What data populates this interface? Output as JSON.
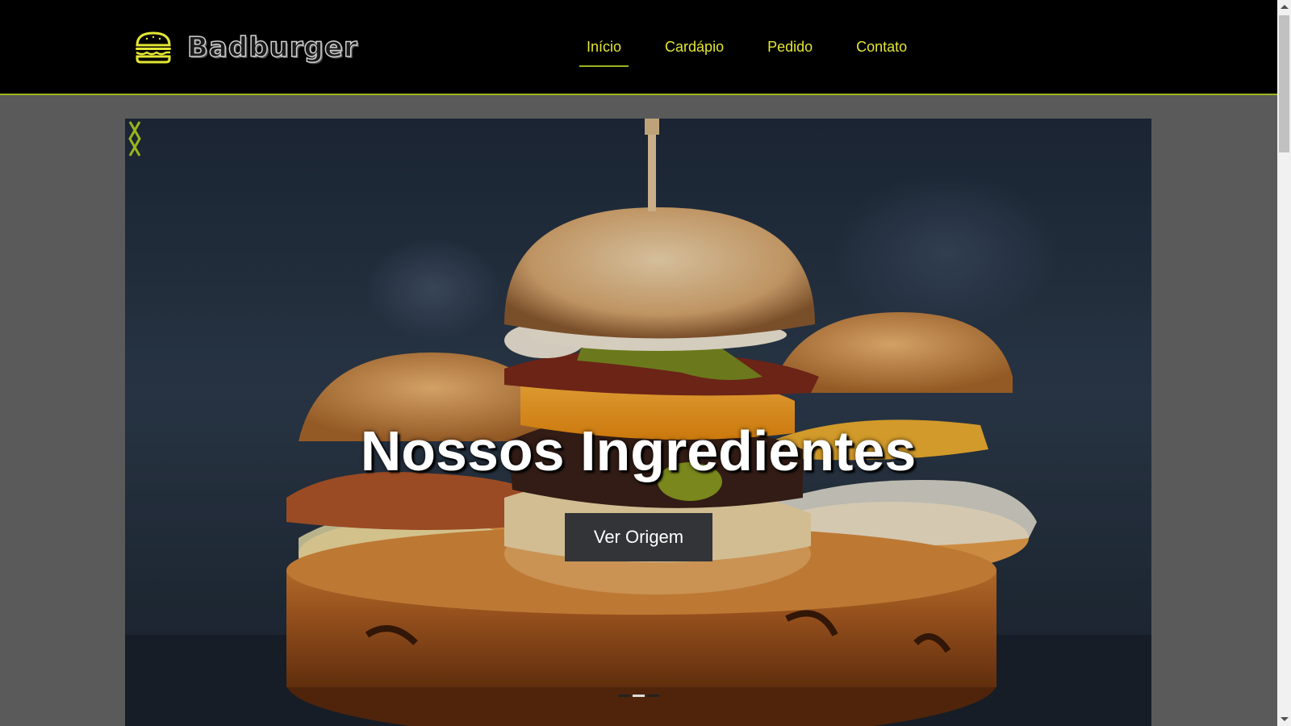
{
  "brand": {
    "name": "Badburger",
    "accent_color": "#e3e634",
    "line_color": "#9bb51a"
  },
  "nav": {
    "items": [
      {
        "label": "Início",
        "active": true
      },
      {
        "label": "Cardápio",
        "active": false
      },
      {
        "label": "Pedido",
        "active": false
      },
      {
        "label": "Contato",
        "active": false
      }
    ]
  },
  "hero": {
    "title": "Nossos Ingredientes",
    "button_label": "Ver Origem",
    "image_subject": "burger-photo",
    "slides_active_index": 1,
    "slides_count": 3
  },
  "icons": {
    "logo": "burger-icon",
    "prev": "chevron-left-icon",
    "next": "chevron-right-icon"
  }
}
